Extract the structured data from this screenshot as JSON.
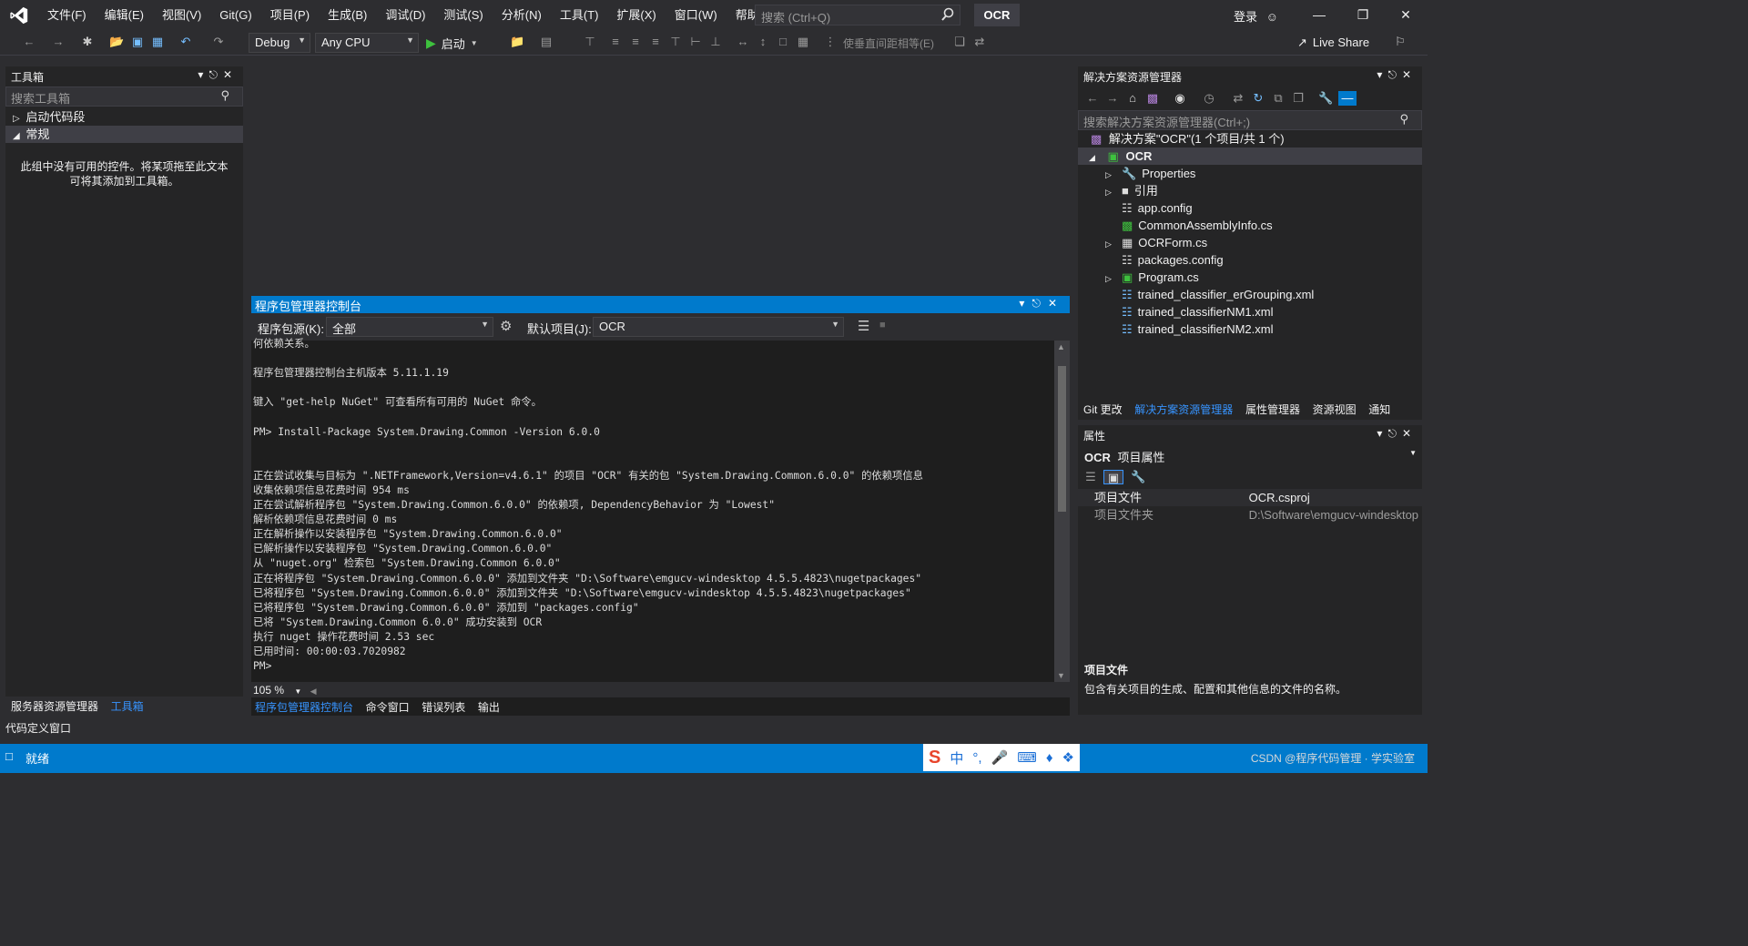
{
  "window": {
    "project_badge": "OCR",
    "search_placeholder": "搜索 (Ctrl+Q)",
    "login_label": "登录",
    "menu": [
      "文件(F)",
      "编辑(E)",
      "视图(V)",
      "Git(G)",
      "项目(P)",
      "生成(B)",
      "调试(D)",
      "测试(S)",
      "分析(N)",
      "工具(T)",
      "扩展(X)",
      "窗口(W)",
      "帮助(H)"
    ]
  },
  "toolbar": {
    "config": "Debug",
    "platform": "Any CPU",
    "start_label": "启动",
    "spacing_label": "使垂直间距相等(E)",
    "live_share": "Live Share"
  },
  "toolbox": {
    "title": "工具箱",
    "search_placeholder": "搜索工具箱",
    "groups": [
      "启动代码段",
      "常规"
    ],
    "empty_message_line1": "此组中没有可用的控件。将某项拖至此文本",
    "empty_message_line2": "可将其添加到工具箱。",
    "bottom_tabs": [
      "服务器资源管理器",
      "工具箱"
    ],
    "code_def": "代码定义窗口"
  },
  "console": {
    "title": "程序包管理器控制台",
    "source_label": "程序包源(K):",
    "source_value": "全部",
    "project_label": "默认项目(J):",
    "project_value": "OCR",
    "zoom": "105 %",
    "lines": [
      "何依赖关系。",
      "",
      "程序包管理器控制台主机版本 5.11.1.19",
      "",
      "键入 \"get-help NuGet\" 可查看所有可用的 NuGet 命令。",
      "",
      "PM> Install-Package System.Drawing.Common -Version 6.0.0",
      "",
      "",
      "正在尝试收集与目标为 \".NETFramework,Version=v4.6.1\" 的项目 \"OCR\" 有关的包 \"System.Drawing.Common.6.0.0\" 的依赖项信息",
      "收集依赖项信息花费时间 954 ms",
      "正在尝试解析程序包 \"System.Drawing.Common.6.0.0\" 的依赖项, DependencyBehavior 为 \"Lowest\"",
      "解析依赖项信息花费时间 0 ms",
      "正在解析操作以安装程序包 \"System.Drawing.Common.6.0.0\"",
      "已解析操作以安装程序包 \"System.Drawing.Common.6.0.0\"",
      "从 \"nuget.org\" 检索包 \"System.Drawing.Common 6.0.0\"",
      "正在将程序包 \"System.Drawing.Common.6.0.0\" 添加到文件夹 \"D:\\Software\\emgucv-windesktop 4.5.5.4823\\nugetpackages\"",
      "已将程序包 \"System.Drawing.Common.6.0.0\" 添加到文件夹 \"D:\\Software\\emgucv-windesktop 4.5.5.4823\\nugetpackages\"",
      "已将程序包 \"System.Drawing.Common.6.0.0\" 添加到 \"packages.config\"",
      "已将 \"System.Drawing.Common 6.0.0\" 成功安装到 OCR",
      "执行 nuget 操作花费时间 2.53 sec",
      "已用时间: 00:00:03.7020982",
      "PM>"
    ],
    "bottom_tabs": [
      "程序包管理器控制台",
      "命令窗口",
      "错误列表",
      "输出"
    ]
  },
  "solution": {
    "title": "解决方案资源管理器",
    "search_placeholder": "搜索解决方案资源管理器(Ctrl+;)",
    "root": "解决方案\"OCR\"(1 个项目/共 1 个)",
    "project": "OCR",
    "items": [
      "Properties",
      "引用",
      "app.config",
      "CommonAssemblyInfo.cs",
      "OCRForm.cs",
      "packages.config",
      "Program.cs",
      "trained_classifier_erGrouping.xml",
      "trained_classifierNM1.xml",
      "trained_classifierNM2.xml"
    ],
    "bottom_tabs": [
      "Git 更改",
      "解决方案资源管理器",
      "属性管理器",
      "资源视图",
      "通知"
    ]
  },
  "properties": {
    "title": "属性",
    "object_name": "OCR",
    "object_type": "项目属性",
    "rows": [
      {
        "name": "项目文件",
        "value": "OCR.csproj"
      },
      {
        "name": "项目文件夹",
        "value": "D:\\Software\\emgucv-windesktop"
      }
    ],
    "desc_title": "项目文件",
    "desc_text": "包含有关项目的生成、配置和其他信息的文件的名称。"
  },
  "status": {
    "text": "就绪",
    "right_text": "CSDN @程序代码管理 · 学实验室"
  },
  "ime": {
    "lang": "中"
  },
  "colors": {
    "accent": "#007acc",
    "link": "#3794ff"
  }
}
